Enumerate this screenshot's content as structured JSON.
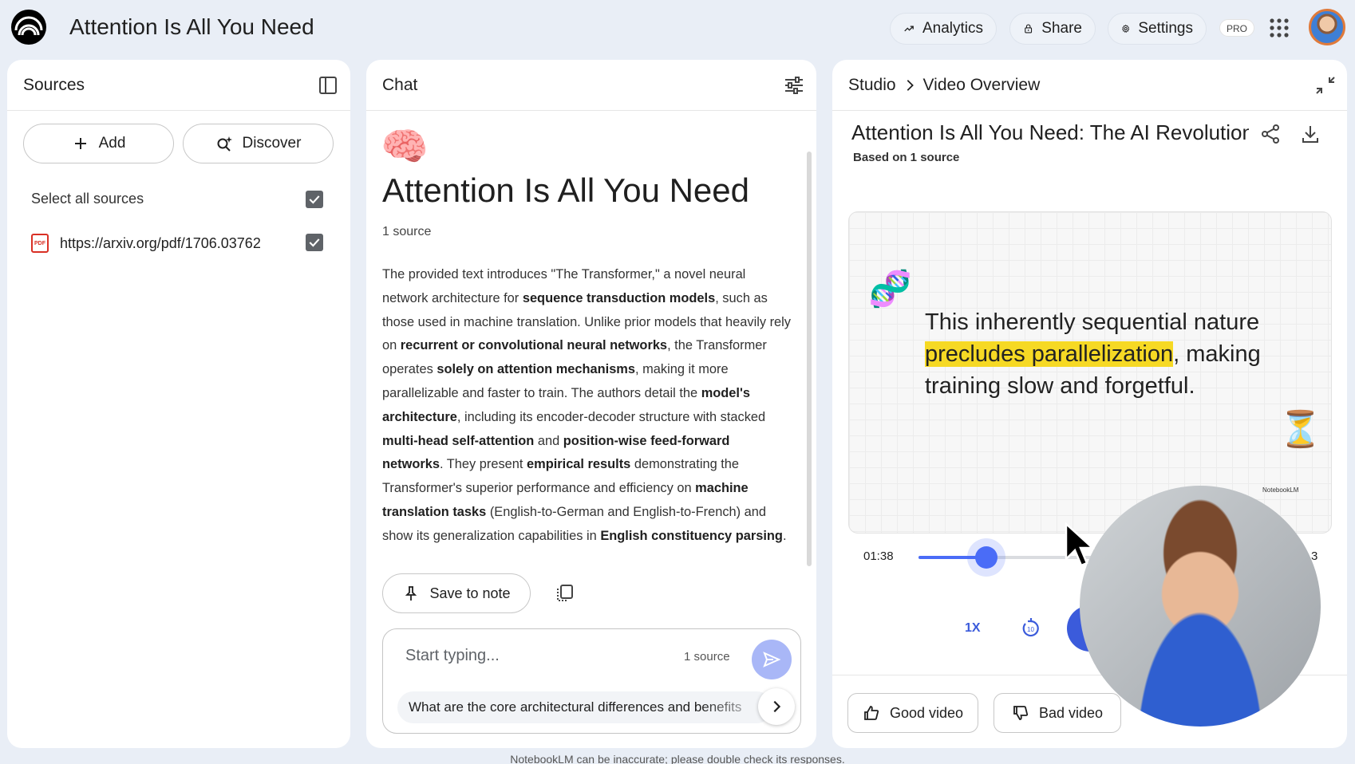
{
  "app": {
    "title": "Attention Is All You Need"
  },
  "topbar": {
    "analytics_label": "Analytics",
    "share_label": "Share",
    "settings_label": "Settings",
    "pro_badge": "PRO"
  },
  "sources": {
    "header": "Sources",
    "add_label": "Add",
    "discover_label": "Discover",
    "select_all_label": "Select all sources",
    "items": [
      {
        "label": "https://arxiv.org/pdf/1706.03762",
        "icon": "pdf-icon",
        "checked": true
      }
    ]
  },
  "chat": {
    "header": "Chat",
    "emoji": "🧠",
    "title": "Attention Is All You Need",
    "source_count": "1 source",
    "save_to_note_label": "Save to note",
    "composer_placeholder": "Start typing...",
    "composer_source_count": "1 source",
    "suggestion": "What are the core architectural differences and benefits"
  },
  "studio": {
    "breadcrumb_root": "Studio",
    "breadcrumb_current": "Video Overview",
    "video_title": "Attention Is All You Need: The AI Revolution",
    "based_on": "Based on 1 source",
    "slide_text_1": "This inherently sequential nature ",
    "slide_highlight": "precludes parallelization",
    "slide_text_2": ", making training slow and forgetful.",
    "watermark": "NotebookLM",
    "current_time": "01:38",
    "end_time_partial": "3",
    "progress": 0.18,
    "speed": "1X",
    "good_video_label": "Good video",
    "bad_video_label": "Bad video"
  },
  "footer": {
    "disclaimer": "NotebookLM can be inaccurate; please double check its responses."
  },
  "colors": {
    "accent": "#4a6cf7",
    "highlight": "#f6d924",
    "background": "#e9eef6"
  }
}
